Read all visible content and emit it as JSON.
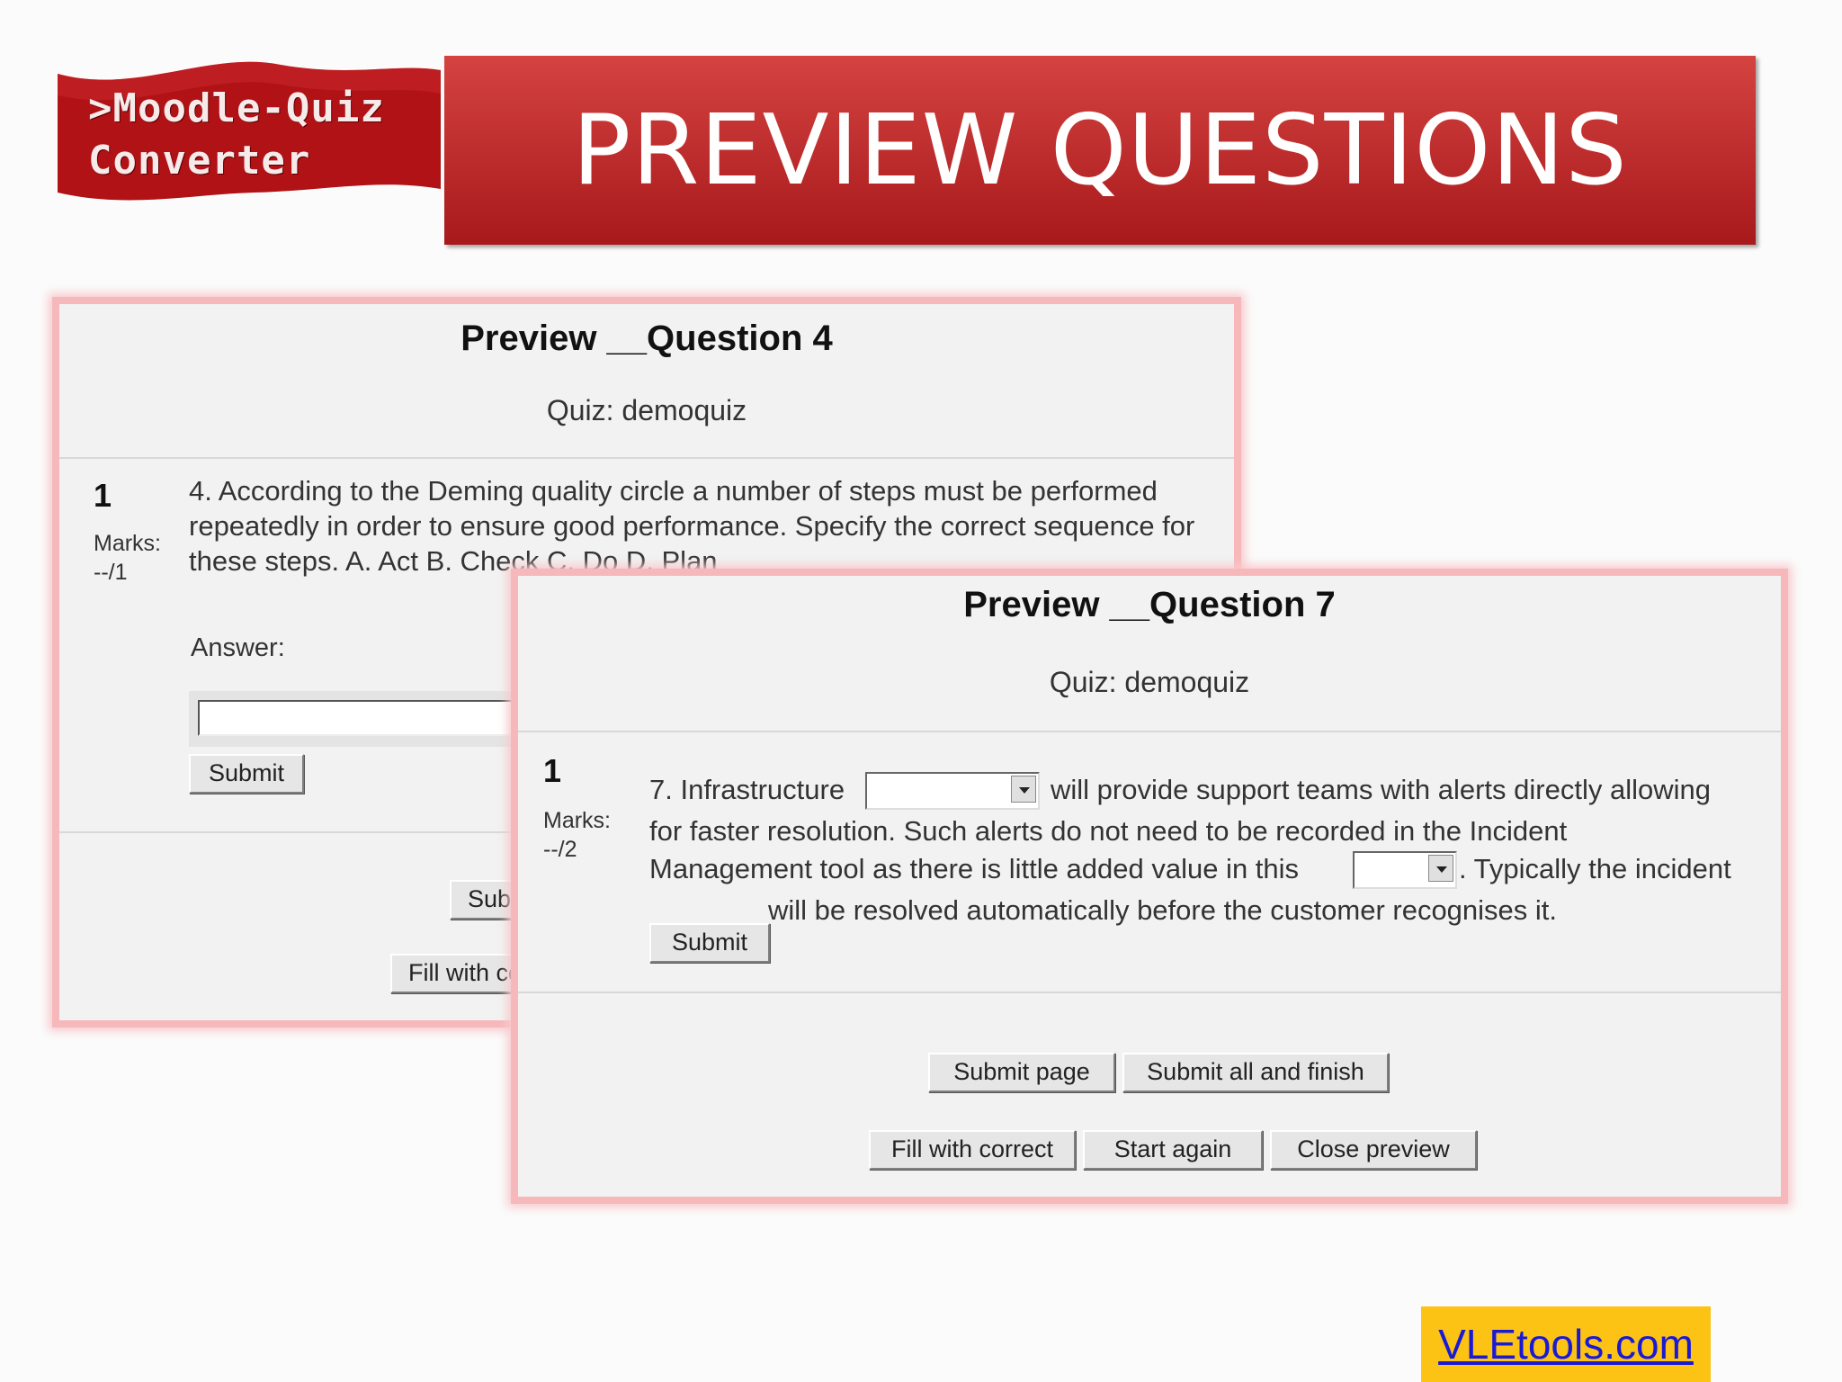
{
  "logo": {
    "line1": ">Moodle-Quiz",
    "line2": "Converter"
  },
  "slide_title": "PREVIEW QUESTIONS",
  "preview_q4": {
    "title": "Preview __Question 4",
    "quiz": "Quiz: demoquiz",
    "qnum": "1",
    "marks_label": "Marks:",
    "marks_value": "--/1",
    "text": "4. According to the Deming quality circle a number of steps must be performed repeatedly in order to ensure good performance. Specify the correct sequence for these steps. A. Act B. Check C. Do D. Plan",
    "answer_label": "Answer:",
    "answer_value": "",
    "submit": "Submit",
    "submit_page_partial": "Subm",
    "fill_partial": "Fill with cor"
  },
  "preview_q7": {
    "title": "Preview __Question 7",
    "quiz": "Quiz: demoquiz",
    "qnum": "1",
    "marks_label": "Marks:",
    "marks_value": "--/2",
    "text_part1": "7. Infrastructure",
    "text_part2": "will provide support teams with alerts directly allowing",
    "text_line2": "for faster resolution. Such alerts do not need to be recorded in the Incident",
    "text_line3a": "Management tool as there is little added value in this",
    "text_line3b": ". Typically the incident",
    "text_line4": "will be resolved automatically before the customer recognises it.",
    "select1_value": "",
    "select2_value": "",
    "submit": "Submit",
    "submit_page": "Submit page",
    "submit_all": "Submit all and finish",
    "fill_correct": "Fill with correct",
    "start_again": "Start again",
    "close_preview": "Close preview"
  },
  "footer": {
    "link": "VLEtools.com"
  },
  "colors": {
    "title_bar": "#c0302f",
    "panel_border": "#f7b8bb",
    "footer_bg": "#fcc214",
    "link": "#1a1ad6"
  }
}
